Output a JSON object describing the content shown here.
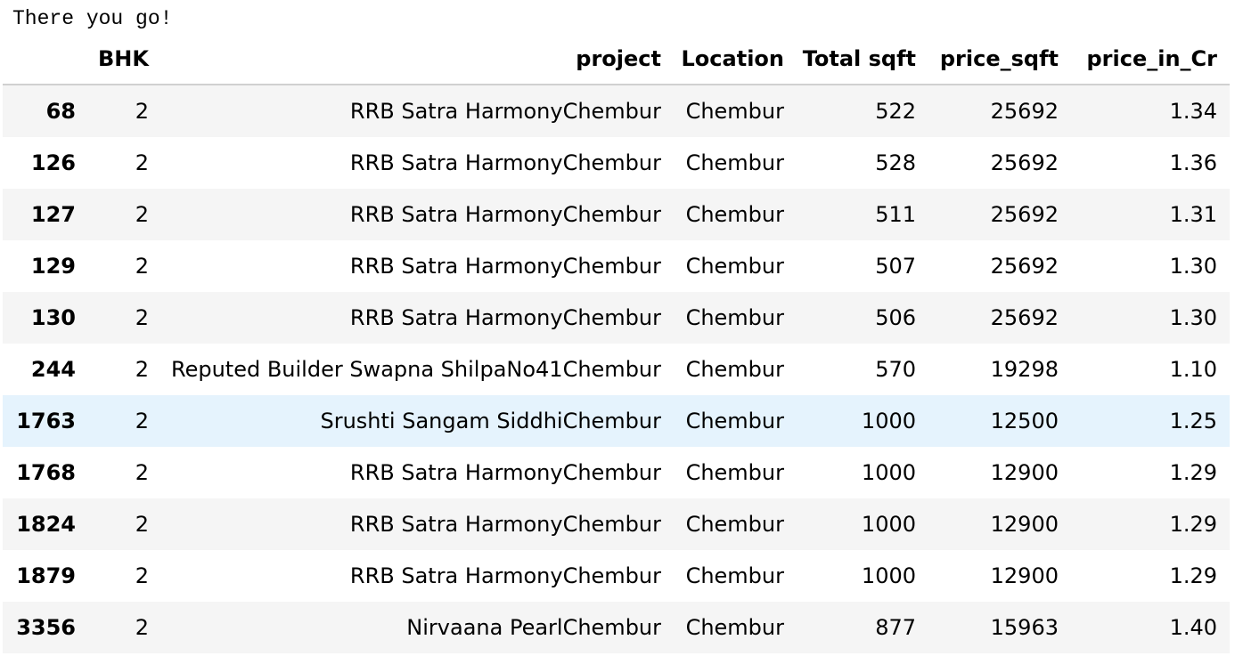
{
  "output_text": "There you go!",
  "table": {
    "index_header": "",
    "columns": [
      "BHK",
      "project",
      "Location",
      "Total sqft",
      "price_sqft",
      "price_in_Cr"
    ],
    "rows": [
      {
        "index": "68",
        "cells": [
          "2",
          "RRB Satra HarmonyChembur",
          "Chembur",
          "522",
          "25692",
          "1.34"
        ]
      },
      {
        "index": "126",
        "cells": [
          "2",
          "RRB Satra HarmonyChembur",
          "Chembur",
          "528",
          "25692",
          "1.36"
        ]
      },
      {
        "index": "127",
        "cells": [
          "2",
          "RRB Satra HarmonyChembur",
          "Chembur",
          "511",
          "25692",
          "1.31"
        ]
      },
      {
        "index": "129",
        "cells": [
          "2",
          "RRB Satra HarmonyChembur",
          "Chembur",
          "507",
          "25692",
          "1.30"
        ]
      },
      {
        "index": "130",
        "cells": [
          "2",
          "RRB Satra HarmonyChembur",
          "Chembur",
          "506",
          "25692",
          "1.30"
        ]
      },
      {
        "index": "244",
        "cells": [
          "2",
          "Reputed Builder Swapna ShilpaNo41Chembur",
          "Chembur",
          "570",
          "19298",
          "1.10"
        ]
      },
      {
        "index": "1763",
        "cells": [
          "2",
          "Srushti Sangam SiddhiChembur",
          "Chembur",
          "1000",
          "12500",
          "1.25"
        ]
      },
      {
        "index": "1768",
        "cells": [
          "2",
          "RRB Satra HarmonyChembur",
          "Chembur",
          "1000",
          "12900",
          "1.29"
        ]
      },
      {
        "index": "1824",
        "cells": [
          "2",
          "RRB Satra HarmonyChembur",
          "Chembur",
          "1000",
          "12900",
          "1.29"
        ]
      },
      {
        "index": "1879",
        "cells": [
          "2",
          "RRB Satra HarmonyChembur",
          "Chembur",
          "1000",
          "12900",
          "1.29"
        ]
      },
      {
        "index": "3356",
        "cells": [
          "2",
          "Nirvaana PearlChembur",
          "Chembur",
          "877",
          "15963",
          "1.40"
        ]
      }
    ]
  },
  "colors": {
    "odd_row": "#f5f5f5",
    "even_row": "#ffffff",
    "hover_row": "#e5f3fd",
    "header_border": "#d0d0d0"
  }
}
